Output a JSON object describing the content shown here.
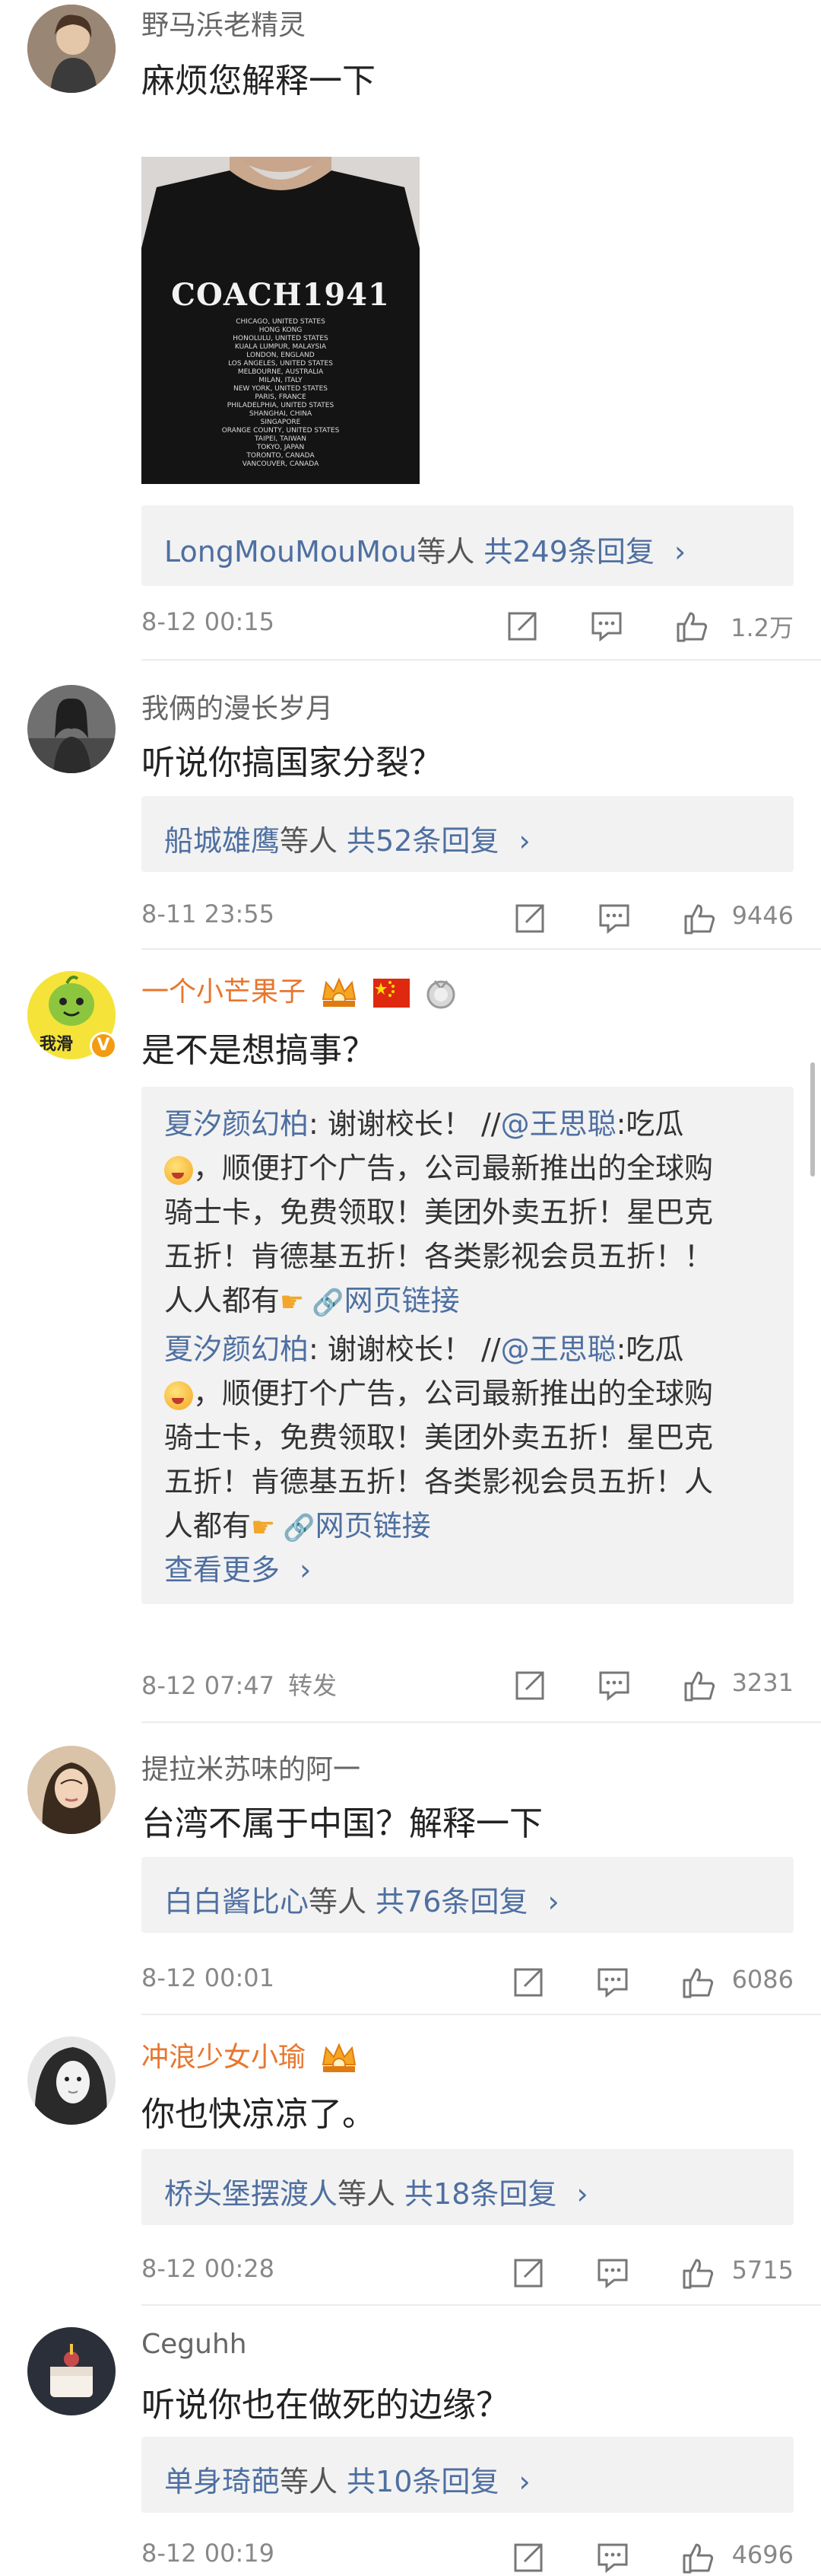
{
  "comments": [
    {
      "user": "野马浜老精灵",
      "text": "麻烦您解释一下",
      "reply_users": "LongMouMouMou",
      "reply_suffix": "等人",
      "reply_count": "共249条回复",
      "time": "8-12 00:15",
      "likes": "1.2万",
      "image_text": {
        "title": "COACH1941",
        "cities": [
          "CHICAGO, UNITED STATES",
          "HONG KONG",
          "HONOLULU, UNITED STATES",
          "KUALA LUMPUR, MALAYSIA",
          "LONDON, ENGLAND",
          "LOS ANGELES, UNITED STATES",
          "MELBOURNE, AUSTRALIA",
          "MILAN, ITALY",
          "NEW YORK, UNITED STATES",
          "PARIS, FRANCE",
          "PHILADELPHIA, UNITED STATES",
          "SHANGHAI, CHINA",
          "SINGAPORE",
          "ORANGE COUNTY, UNITED STATES",
          "TAIPEI, TAIWAN",
          "TOKYO, JAPAN",
          "TORONTO, CANADA",
          "VANCOUVER, CANADA"
        ]
      }
    },
    {
      "user": "我俩的漫长岁月",
      "text": "听说你搞国家分裂？",
      "reply_users": "船城雄鹰",
      "reply_suffix": "等人",
      "reply_count": "共52条回复",
      "time": "8-11 23:55",
      "likes": "9446"
    },
    {
      "user": "一个小芒果子",
      "avatar_text": "我滑",
      "text": "是不是想搞事？",
      "reply1": {
        "user": "夏汐颜幻柏",
        "mid": ": 谢谢校长！ //",
        "mention": "@王思聪",
        "line1_end": ":吃瓜",
        "line2": "，顺便打个广告，公司最新推出的全球购",
        "line3": "骑士卡，免费领取！美团外卖五折！星巴克",
        "line4": "五折！肯德基五折！各类影视会员五折！！",
        "line5_pre": "人人都有",
        "link": "网页链接"
      },
      "reply2": {
        "user": "夏汐颜幻柏",
        "mid": ": 谢谢校长！ //",
        "mention": "@王思聪",
        "line1_end": ":吃瓜",
        "line2": "，顺便打个广告，公司最新推出的全球购",
        "line3": "骑士卡，免费领取！美团外卖五折！星巴克",
        "line4": "五折！肯德基五折！各类影视会员五折！人",
        "line5_pre": "人都有",
        "link": "网页链接"
      },
      "see_more": "查看更多",
      "time": "8-12 07:47",
      "forward": "转发",
      "likes": "3231"
    },
    {
      "user": "提拉米苏味的阿一",
      "text": "台湾不属于中国？解释一下",
      "reply_users": "白白酱比心",
      "reply_suffix": "等人",
      "reply_count": "共76条回复",
      "time": "8-12 00:01",
      "likes": "6086"
    },
    {
      "user": "冲浪少女小瑜",
      "text": "你也快凉凉了。",
      "reply_users": "桥头堡摆渡人",
      "reply_suffix": "等人",
      "reply_count": "共18条回复",
      "time": "8-12 00:28",
      "likes": "5715"
    },
    {
      "user": "Ceguhh",
      "text": "听说你也在做死的边缘？",
      "reply_users": "单身琦葩",
      "reply_suffix": "等人",
      "reply_count": "共10条回复",
      "time": "8-12 00:19",
      "likes": "4696"
    }
  ],
  "colors": {
    "link_blue": "#4e6fa1",
    "orange_name": "#e8762e",
    "reply_bg": "#f2f2f2",
    "meta_grey": "#888888"
  }
}
